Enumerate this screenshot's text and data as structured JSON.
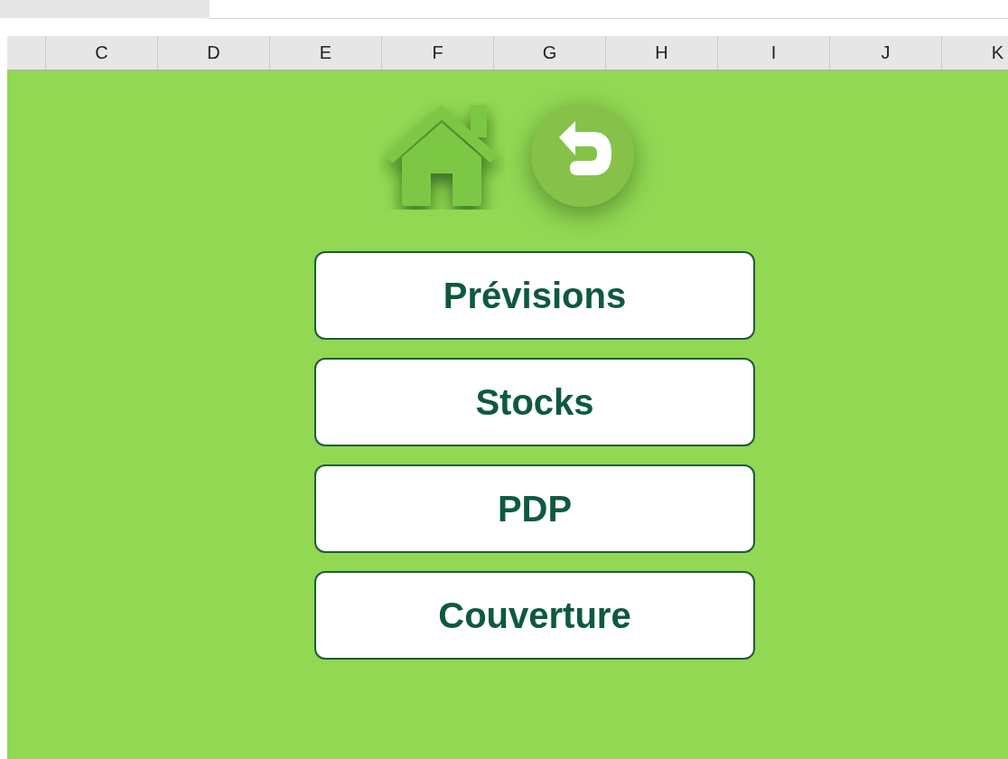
{
  "column_headers": [
    "C",
    "D",
    "E",
    "F",
    "G",
    "H",
    "I",
    "J",
    "K"
  ],
  "buttons": [
    {
      "label": "Prévisions"
    },
    {
      "label": "Stocks"
    },
    {
      "label": "PDP"
    },
    {
      "label": "Couverture"
    }
  ]
}
